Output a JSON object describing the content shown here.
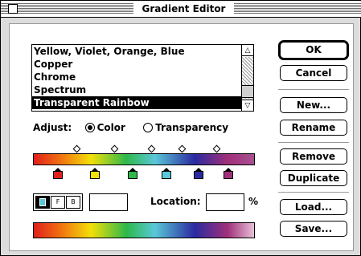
{
  "window": {
    "title": "Gradient Editor"
  },
  "gradient_list": {
    "items": [
      {
        "label": "Yellow, Violet, Orange, Blue",
        "selected": false
      },
      {
        "label": "Copper",
        "selected": false
      },
      {
        "label": "Chrome",
        "selected": false
      },
      {
        "label": "Spectrum",
        "selected": false
      },
      {
        "label": "Transparent Rainbow",
        "selected": true
      }
    ]
  },
  "adjust": {
    "label": "Adjust:",
    "options": [
      {
        "label": "Color",
        "selected": true
      },
      {
        "label": "Transparency",
        "selected": false
      }
    ]
  },
  "gradient": {
    "colors": [
      "#e0201c",
      "#f4e00a",
      "#2eb84a",
      "#5ac8d8",
      "#2a2aa0",
      "#a0307a"
    ]
  },
  "stop_editor": {
    "location_label": "Location:",
    "location_value": "",
    "percent_label": "%"
  },
  "buttons": {
    "ok": "OK",
    "cancel": "Cancel",
    "new": "New...",
    "rename": "Rename",
    "remove": "Remove",
    "duplicate": "Duplicate",
    "load": "Load...",
    "save": "Save..."
  }
}
